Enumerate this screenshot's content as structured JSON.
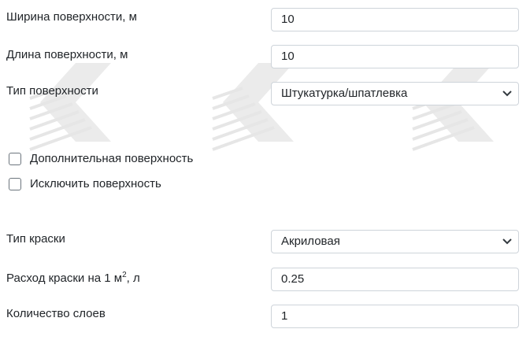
{
  "form": {
    "width": {
      "label": "Ширина поверхности, м",
      "value": "10"
    },
    "length": {
      "label": "Длина поверхности, м",
      "value": "10"
    },
    "surface_type": {
      "label": "Тип поверхности",
      "selected": "Штукатурка/шпатлевка"
    },
    "additional_surface": {
      "label": "Дополнительная поверхность",
      "checked": false
    },
    "exclude_surface": {
      "label": "Исключить поверхность",
      "checked": false
    },
    "paint_type": {
      "label": "Тип краски",
      "selected": "Акриловая"
    },
    "consumption": {
      "label_prefix": "Расход краски на 1 м",
      "label_sup": "2",
      "label_suffix": ", л",
      "value": "0.25"
    },
    "layers": {
      "label": "Количество слоев",
      "value": "1"
    }
  },
  "icons": {
    "dropdown": "chevron-down-icon",
    "watermark": "brush-logo-watermark"
  },
  "colors": {
    "border": "#ced4da",
    "text": "#212529",
    "watermark": "#e8e8e8"
  }
}
